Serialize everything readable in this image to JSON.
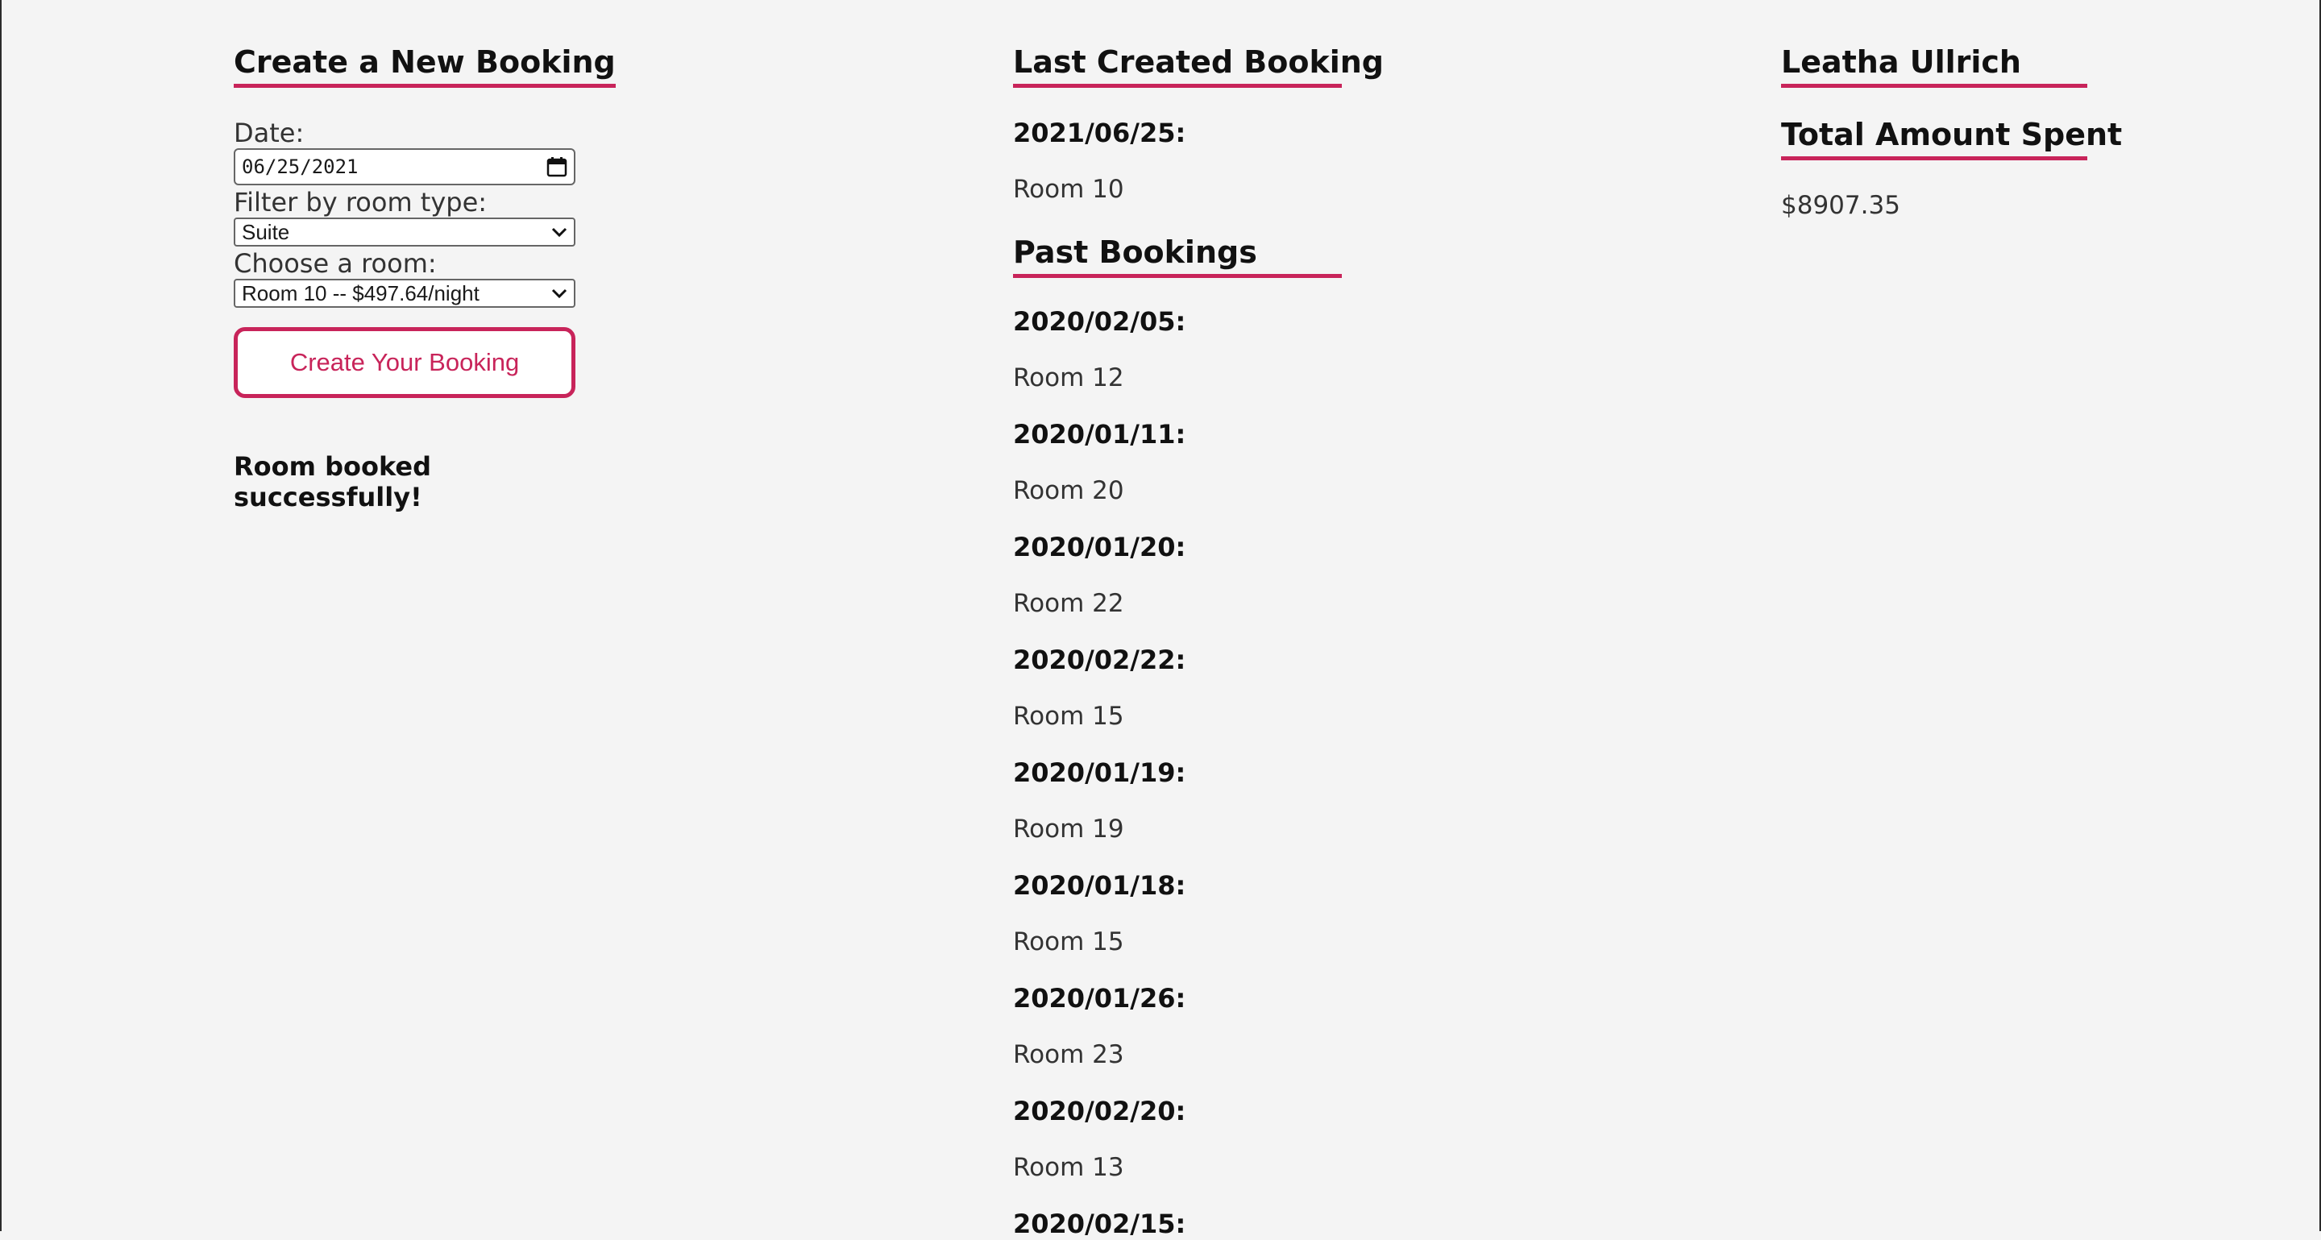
{
  "create": {
    "title": "Create a New Booking",
    "date_label": "Date:",
    "date_value": "06/25/2021",
    "filter_label": "Filter by room type:",
    "filter_value": "Suite",
    "room_label": "Choose a room:",
    "room_value": "Room 10 -- $497.64/night",
    "button_label": "Create Your Booking",
    "status_message": "Room booked successfully!"
  },
  "last_booking": {
    "title": "Last Created Booking",
    "date": "2021/06/25:",
    "room": "Room 10"
  },
  "past": {
    "title": "Past Bookings",
    "items": [
      {
        "date": "2020/02/05:",
        "room": "Room 12"
      },
      {
        "date": "2020/01/11:",
        "room": "Room 20"
      },
      {
        "date": "2020/01/20:",
        "room": "Room 22"
      },
      {
        "date": "2020/02/22:",
        "room": "Room 15"
      },
      {
        "date": "2020/01/19:",
        "room": "Room 19"
      },
      {
        "date": "2020/01/18:",
        "room": "Room 15"
      },
      {
        "date": "2020/01/26:",
        "room": "Room 23"
      },
      {
        "date": "2020/02/20:",
        "room": "Room 13"
      },
      {
        "date": "2020/02/15:",
        "room": ""
      }
    ]
  },
  "user": {
    "name": "Leatha Ullrich",
    "total_title": "Total Amount Spent",
    "total_amount": "$8907.35"
  },
  "colors": {
    "accent": "#c8245a",
    "background": "#f4f4f4"
  }
}
